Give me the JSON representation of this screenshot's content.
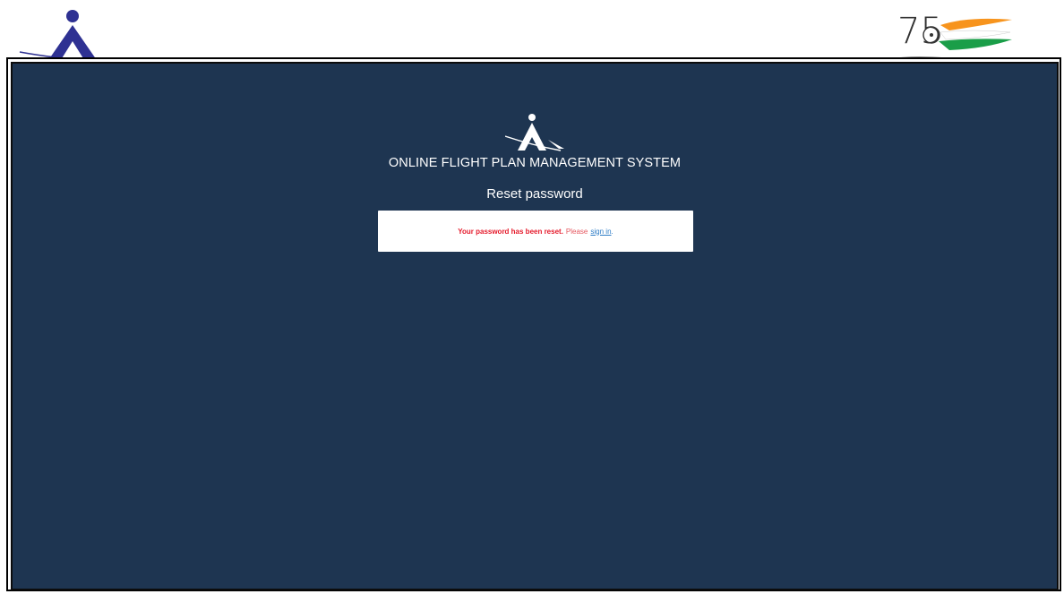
{
  "header": {
    "left_logo_icon": "aai-logo-icon",
    "right_logo_icon": "azadi-ka-amrit-mahotsav-75-logo-icon",
    "right_logo_text": "75",
    "brand_colors": {
      "aai_blue": "#2e3192",
      "saffron": "#f7941d",
      "green": "#1a9e48",
      "panel_bg": "#1e3551"
    }
  },
  "main": {
    "app_title": "ONLINE FLIGHT PLAN MANAGEMENT SYSTEM",
    "form_title": "Reset password",
    "message": {
      "strong": "Your password has been reset.",
      "normal": "Please",
      "link": "sign in",
      "end": "."
    }
  }
}
